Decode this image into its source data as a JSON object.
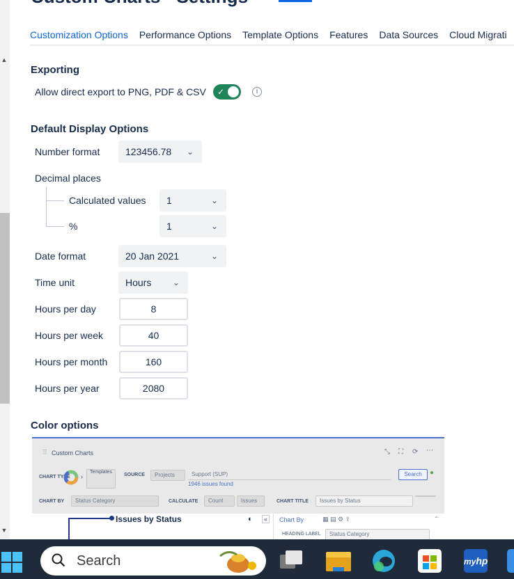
{
  "page": {
    "title": "Custom Charts - Settings"
  },
  "tabs": [
    {
      "label": "Customization Options",
      "active": true
    },
    {
      "label": "Performance Options",
      "active": false
    },
    {
      "label": "Template Options",
      "active": false
    },
    {
      "label": "Features",
      "active": false
    },
    {
      "label": "Data Sources",
      "active": false
    },
    {
      "label": "Cloud Migrati",
      "active": false
    }
  ],
  "exporting": {
    "heading": "Exporting",
    "allow_export_label": "Allow direct export to PNG, PDF & CSV",
    "allow_export_enabled": true
  },
  "display": {
    "heading": "Default Display Options",
    "number_format_label": "Number format",
    "number_format_value": "123456.78",
    "decimal_places_label": "Decimal places",
    "calculated_values_label": "Calculated values",
    "calculated_values_value": "1",
    "percent_label": "%",
    "percent_value": "1",
    "date_format_label": "Date format",
    "date_format_value": "20 Jan 2021",
    "time_unit_label": "Time unit",
    "time_unit_value": "Hours",
    "hours_per_day_label": "Hours per day",
    "hours_per_day_value": "8",
    "hours_per_week_label": "Hours per week",
    "hours_per_week_value": "40",
    "hours_per_month_label": "Hours per month",
    "hours_per_month_value": "160",
    "hours_per_year_label": "Hours per year",
    "hours_per_year_value": "2080"
  },
  "color_options": {
    "heading": "Color options",
    "preview": {
      "title": "Custom Charts",
      "chart_type_label": "CHART TYPE",
      "templates_label": "Templates",
      "source_label": "SOURCE",
      "source_value": "Projects",
      "project_value": "Support (SUP)",
      "search_button": "Search",
      "issues_found": "1946 issues found",
      "chart_by_label": "CHART BY",
      "chart_by_value": "Status Category",
      "calculate_label": "CALCULATE",
      "calculate_value": "Count",
      "calculate_of": "Issues",
      "chart_title_label": "CHART TITLE",
      "chart_title_value": "Issues by Status",
      "chart_heading": "Issues by Status",
      "chart_by_tab": "Chart By",
      "heading_label": "HEADING LABEL",
      "heading_label_value": "Status Category"
    }
  },
  "taskbar": {
    "search_placeholder": "Search"
  },
  "colors": {
    "accent": "#0c66e4",
    "toggle_on": "#1f845a",
    "taskbar": "#1f2b3a"
  }
}
